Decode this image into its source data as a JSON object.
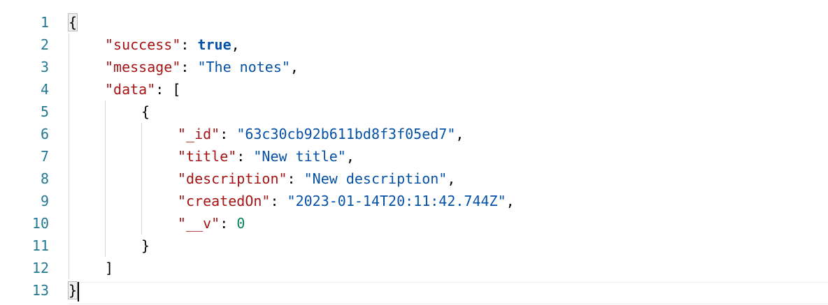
{
  "editor": {
    "line_numbers": [
      "1",
      "2",
      "3",
      "4",
      "5",
      "6",
      "7",
      "8",
      "9",
      "10",
      "11",
      "12",
      "13"
    ],
    "lines": {
      "l1_open": "{",
      "l2_key": "\"success\"",
      "l2_colon": ": ",
      "l2_value": "true",
      "l2_comma": ",",
      "l3_key": "\"message\"",
      "l3_colon": ": ",
      "l3_value": "\"The notes\"",
      "l3_comma": ",",
      "l4_key": "\"data\"",
      "l4_colon": ": ",
      "l4_open": "[",
      "l5_open": "{",
      "l6_key": "\"_id\"",
      "l6_colon": ": ",
      "l6_value": "\"63c30cb92b611bd8f3f05ed7\"",
      "l6_comma": ",",
      "l7_key": "\"title\"",
      "l7_colon": ": ",
      "l7_value": "\"New title\"",
      "l7_comma": ",",
      "l8_key": "\"description\"",
      "l8_colon": ": ",
      "l8_value": "\"New description\"",
      "l8_comma": ",",
      "l9_key": "\"createdOn\"",
      "l9_colon": ": ",
      "l9_value": "\"2023-01-14T20:11:42.744Z\"",
      "l9_comma": ",",
      "l10_key": "\"__v\"",
      "l10_colon": ": ",
      "l10_value": "0",
      "l11_close": "}",
      "l12_close": "]",
      "l13_close": "}"
    }
  },
  "colors": {
    "line_number": "#237893",
    "key": "#a31515",
    "string": "#0451a5",
    "keyword": "#0451a5",
    "number": "#098658"
  }
}
